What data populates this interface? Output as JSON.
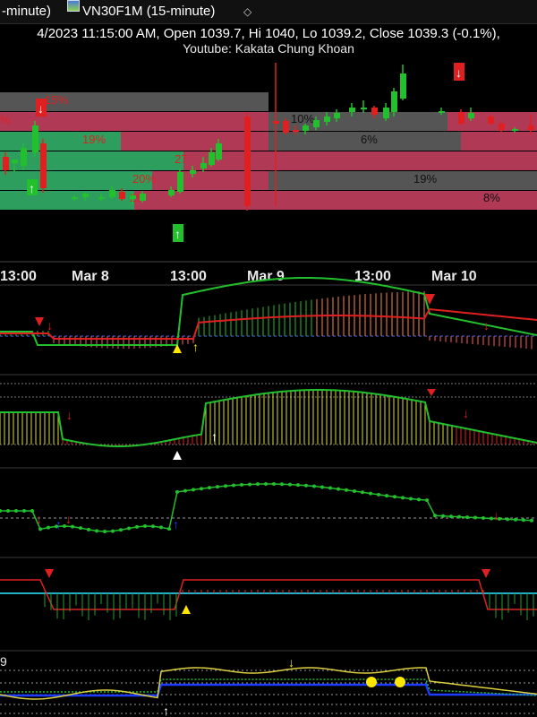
{
  "tabs": {
    "tab1_label": "-minute)",
    "tab2_label": "VN30F1M (15-minute)",
    "pin_icon": "pin-icon"
  },
  "header": {
    "info": "4/2023 11:15:00 AM, Open 1039.7, Hi 1040, Lo 1039.2, Close 1039.3 (-0.1%),",
    "subtitle": "Youtube: Kakata Chung Khoan"
  },
  "time_axis": {
    "labels": [
      "13:00",
      "Mar 8",
      "13:00",
      "Mar 9",
      "13:00",
      "Mar 10"
    ]
  },
  "price_zones": {
    "labels": [
      "15%",
      "%",
      "19%",
      "27",
      "20%",
      "25",
      "10%",
      "6%",
      "19%",
      "8%"
    ]
  },
  "bottom_panel": {
    "label": "9"
  },
  "colors": {
    "up": "#22c02c",
    "down": "#e02020",
    "bg": "#000000",
    "zone_red": "#b03a56",
    "zone_green": "#2e9e5e",
    "zone_gray": "#555555",
    "yellow": "#ffe600",
    "blue": "#1d3cff"
  }
}
